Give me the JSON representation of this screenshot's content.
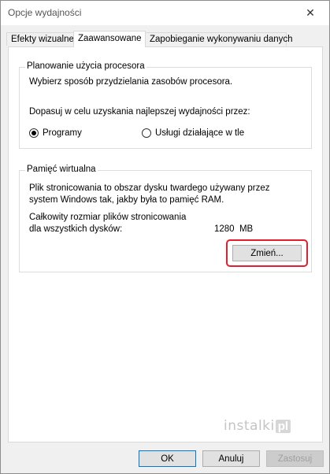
{
  "window": {
    "title": "Opcje wydajności"
  },
  "tabs": [
    {
      "label": "Efekty wizualne"
    },
    {
      "label": "Zaawansowane"
    },
    {
      "label": "Zapobieganie wykonywaniu danych"
    }
  ],
  "cpu": {
    "title": "Planowanie użycia procesora",
    "description": "Wybierz sposób przydzielania zasobów procesora.",
    "adjust": "Dopasuj w celu uzyskania najlepszej wydajności przez:",
    "options": [
      {
        "label": "Programy",
        "selected": true
      },
      {
        "label": "Usługi działające w tle",
        "selected": false
      }
    ]
  },
  "memory": {
    "title": "Pamięć wirtualna",
    "desc_line1": "Plik stronicowania to obszar dysku twardego używany przez",
    "desc_line2": "system Windows tak, jakby była to pamięć RAM.",
    "total_line1": "Całkowity rozmiar plików stronicowania",
    "total_line2": "dla wszystkich dysków:",
    "total_value": "1280  MB",
    "change_label": "Zmień..."
  },
  "buttons": {
    "ok": "OK",
    "cancel": "Anuluj",
    "apply": "Zastosuj"
  },
  "watermark": {
    "text": "instalki",
    "badge": "pl"
  },
  "colors": {
    "highlight": "#e21f2e",
    "default_button_border": "#0078d7"
  }
}
